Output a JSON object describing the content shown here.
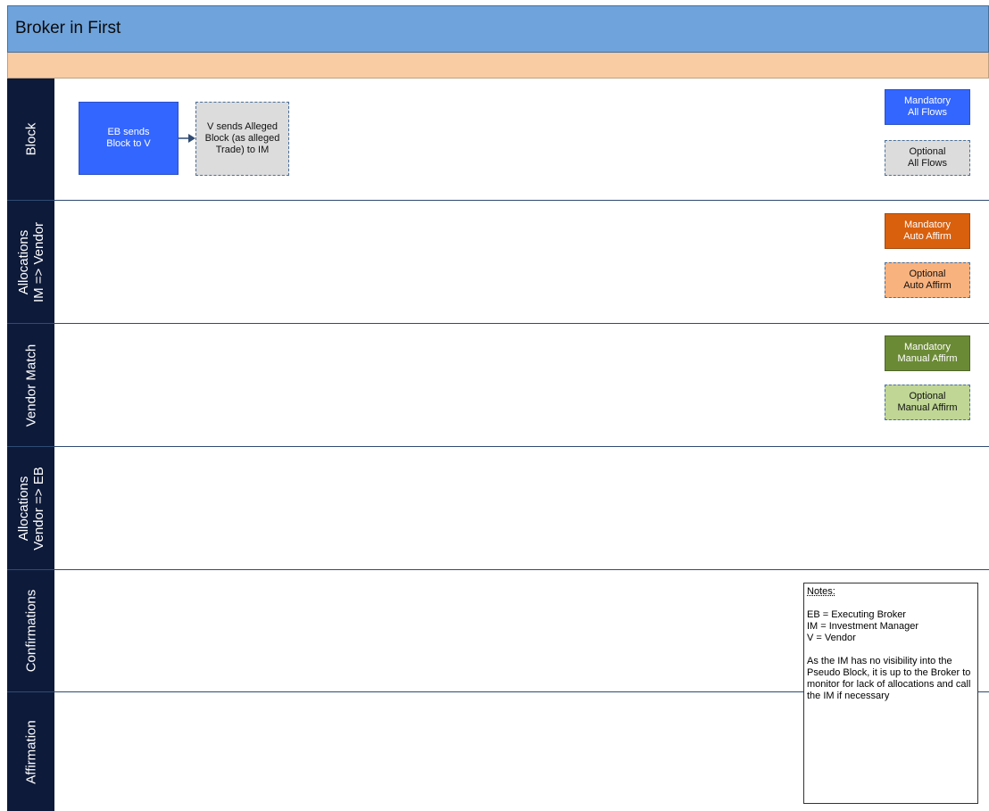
{
  "title": "Broker in First",
  "lanes": [
    {
      "label": "Block"
    },
    {
      "label": "Allocations\nIM => Vendor"
    },
    {
      "label": "Vendor Match"
    },
    {
      "label": "Allocations\nVendor => EB"
    },
    {
      "label": "Confirmations"
    },
    {
      "label": "Affirmation"
    }
  ],
  "flow": {
    "eb_sends": "EB sends\nBlock to V",
    "v_sends": "V sends Alleged\nBlock (as alleged\nTrade) to IM"
  },
  "legend": {
    "mandatory_all": "Mandatory\nAll Flows",
    "optional_all": "Optional\nAll Flows",
    "mandatory_auto": "Mandatory\nAuto Affirm",
    "optional_auto": "Optional\nAuto Affirm",
    "mandatory_manual": "Mandatory\nManual Affirm",
    "optional_manual": "Optional\nManual Affirm"
  },
  "notes": {
    "heading": "Notes:",
    "line1": "EB = Executing Broker",
    "line2": "IM = Investment Manager",
    "line3": "V = Vendor",
    "para": "As the IM has no visibility into the Pseudo Block, it is up to the Broker to monitor for lack of allocations and call the IM if necessary"
  },
  "colors": {
    "title_bar": "#6fa3dc",
    "sub_bar": "#f9cca3",
    "lane_header": "#0d1a3a",
    "mandatory_all": "#3366ff",
    "optional_all": "#dcdcdc",
    "mandatory_auto": "#d9600d",
    "optional_auto": "#f8b27e",
    "mandatory_manual": "#6b8a35",
    "optional_manual": "#bfd695"
  }
}
